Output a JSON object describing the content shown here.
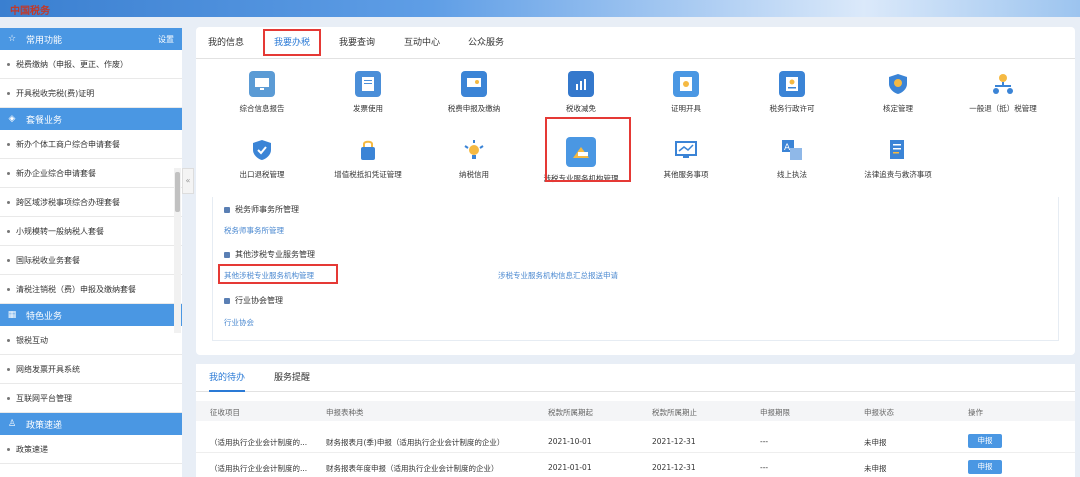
{
  "app": {
    "logo_text": "中国税务"
  },
  "sidebar": {
    "sections": [
      {
        "title": "常用功能",
        "action": "设置",
        "icon": "star-icon",
        "items": [
          "税费缴纳（申报、更正、作废）",
          "开具税收完税(费)证明"
        ]
      },
      {
        "title": "套餐业务",
        "icon": "stack-icon",
        "items": [
          "新办个体工商户综合申请套餐",
          "新办企业综合申请套餐",
          "跨区域涉税事项综合办理套餐",
          "小规模转一般纳税人套餐",
          "国际税收业务套餐",
          "清税注销税（费）申报及缴纳套餐"
        ]
      },
      {
        "title": "特色业务",
        "icon": "grid-icon",
        "items": [
          "银税互动",
          "网络发票开具系统",
          "互联网平台管理"
        ]
      },
      {
        "title": "政策速递",
        "icon": "person-icon",
        "items": [
          "政策速递"
        ]
      }
    ]
  },
  "main": {
    "tabs": [
      "我的信息",
      "我要办税",
      "我要查询",
      "互动中心",
      "公众服务"
    ],
    "active_tab": "我要办税",
    "tiles_row1": [
      "综合信息报告",
      "发票使用",
      "税费申报及缴纳",
      "税收减免",
      "证明开具",
      "税务行政许可",
      "核定管理",
      "一般退（抵）税管理"
    ],
    "tiles_row2": [
      "出口退税管理",
      "增值税抵扣凭证管理",
      "纳税信用",
      "涉税专业服务机构管理",
      "其他服务事项",
      "线上执法",
      "法律追责与救济事项"
    ],
    "submenu": {
      "groups": [
        {
          "title": "税务师事务所管理",
          "links": [
            "税务师事务所管理"
          ]
        },
        {
          "title": "其他涉税专业服务管理",
          "links": [
            "其他涉税专业服务机构管理",
            "涉税专业服务机构信息汇总报送申请"
          ]
        },
        {
          "title": "行业协会管理",
          "links": [
            "行业协会"
          ]
        }
      ]
    }
  },
  "todo": {
    "tabs": [
      "我的待办",
      "服务提醒"
    ],
    "columns": [
      "征收项目",
      "申报表种类",
      "税款所属期起",
      "税款所属期止",
      "申报期限",
      "申报状态",
      "操作"
    ],
    "rows": [
      [
        "（适用执行企业会计制度的...",
        "财务报表月(季)申报（适用执行企业会计制度的企业）",
        "2021-10-01",
        "2021-12-31",
        "---",
        "未申报",
        "申报"
      ],
      [
        "（适用执行企业会计制度的...",
        "财务报表年度申报（适用执行企业会计制度的企业）",
        "2021-01-01",
        "2021-12-31",
        "---",
        "未申报",
        "申报"
      ]
    ]
  },
  "colors": {
    "accent": "#2a7ad6",
    "sidebar_header": "#4a97e3",
    "highlight": "#e53935"
  }
}
